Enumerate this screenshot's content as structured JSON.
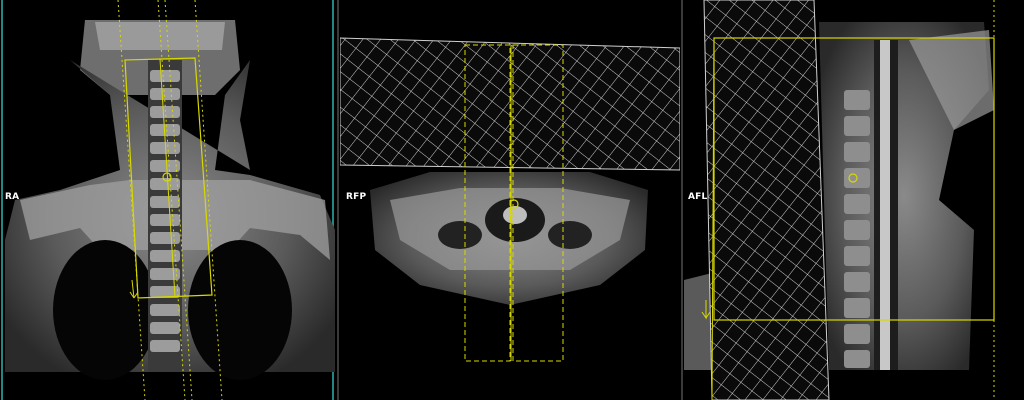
{
  "viewports": [
    {
      "name": "coronal",
      "orientation_label": "RA"
    },
    {
      "name": "axial",
      "orientation_label": "RFP"
    },
    {
      "name": "sagittal",
      "orientation_label": "AFL"
    }
  ],
  "colors": {
    "planning_box": "#d8d800",
    "saturation_band_hatch": "#cfcfcf",
    "viewport_border_active": "#2fb3b0",
    "separator": "#3a3a3a"
  }
}
